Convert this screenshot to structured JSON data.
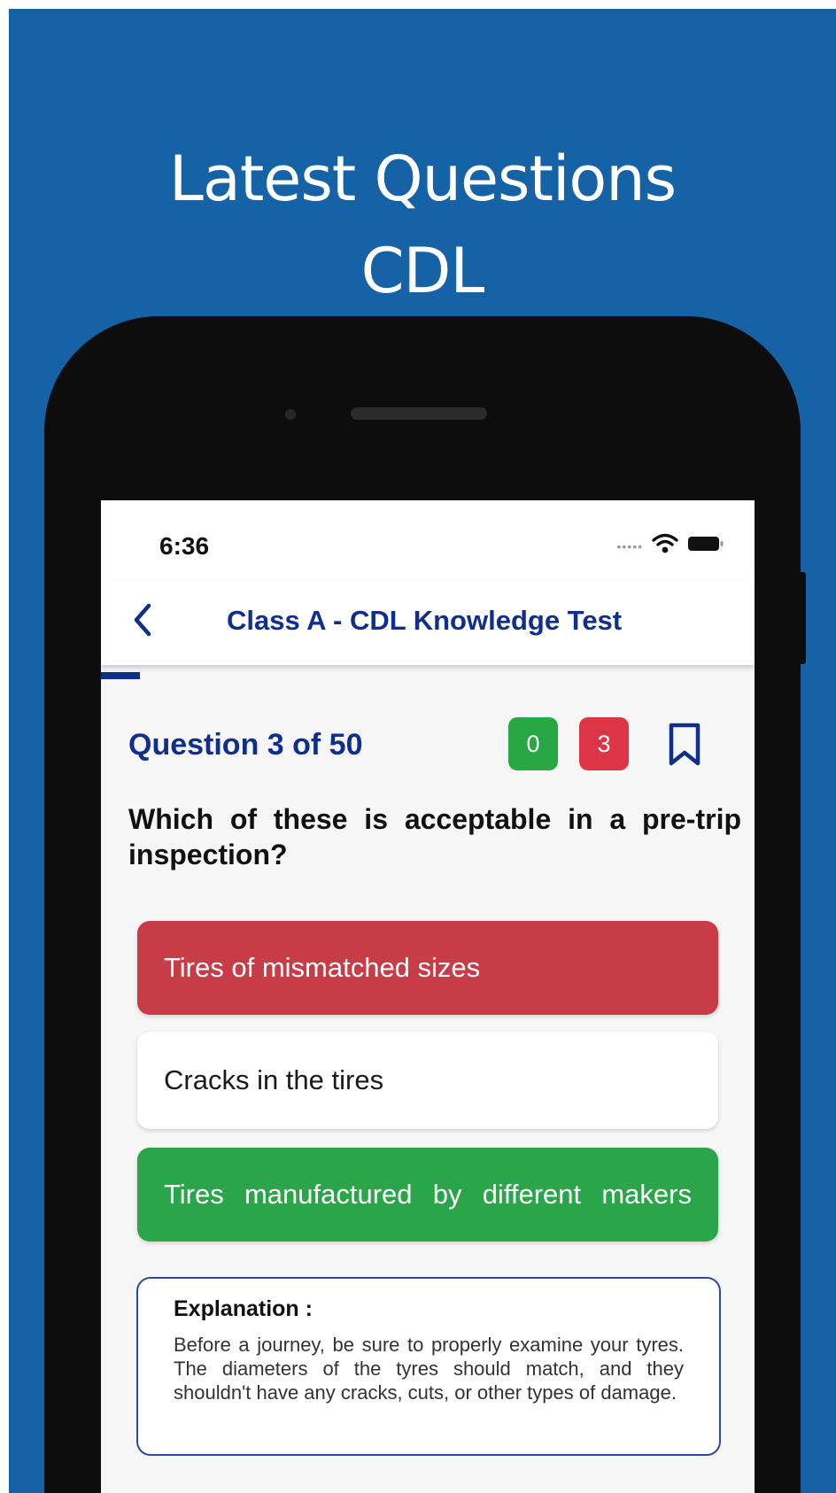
{
  "promo": {
    "headline_line1": "Latest Questions",
    "headline_line2": "CDL"
  },
  "status_bar": {
    "time": "6:36",
    "icons": [
      "signal-dots",
      "wifi-icon",
      "battery-icon"
    ]
  },
  "header": {
    "back_icon": "chevron-left-icon",
    "title": "Class A - CDL Knowledge Test"
  },
  "progress": {
    "current": 3,
    "total": 50,
    "fraction": 0.06
  },
  "question": {
    "counter": "Question 3 of 50",
    "correct_count": "0",
    "wrong_count": "3",
    "bookmark_icon": "bookmark-icon",
    "text": "Which of these is acceptable in a pre-trip inspection?"
  },
  "options": [
    {
      "label": "Tires of mismatched sizes",
      "state": "wrong"
    },
    {
      "label": "Cracks in the tires",
      "state": "neutral"
    },
    {
      "label": "Tires manufactured by different makers",
      "state": "correct"
    }
  ],
  "explanation": {
    "title": "Explanation :",
    "text": "Before a journey, be sure to properly examine your tyres. The diameters of the tyres should match, and they shouldn't have any cracks, cuts, or other types of damage."
  },
  "colors": {
    "background": "#1563a6",
    "accent": "#102f8c",
    "correct": "#28a845",
    "wrong": "#dc3546",
    "option_wrong": "#c73c46",
    "option_correct": "#2aa54a"
  }
}
